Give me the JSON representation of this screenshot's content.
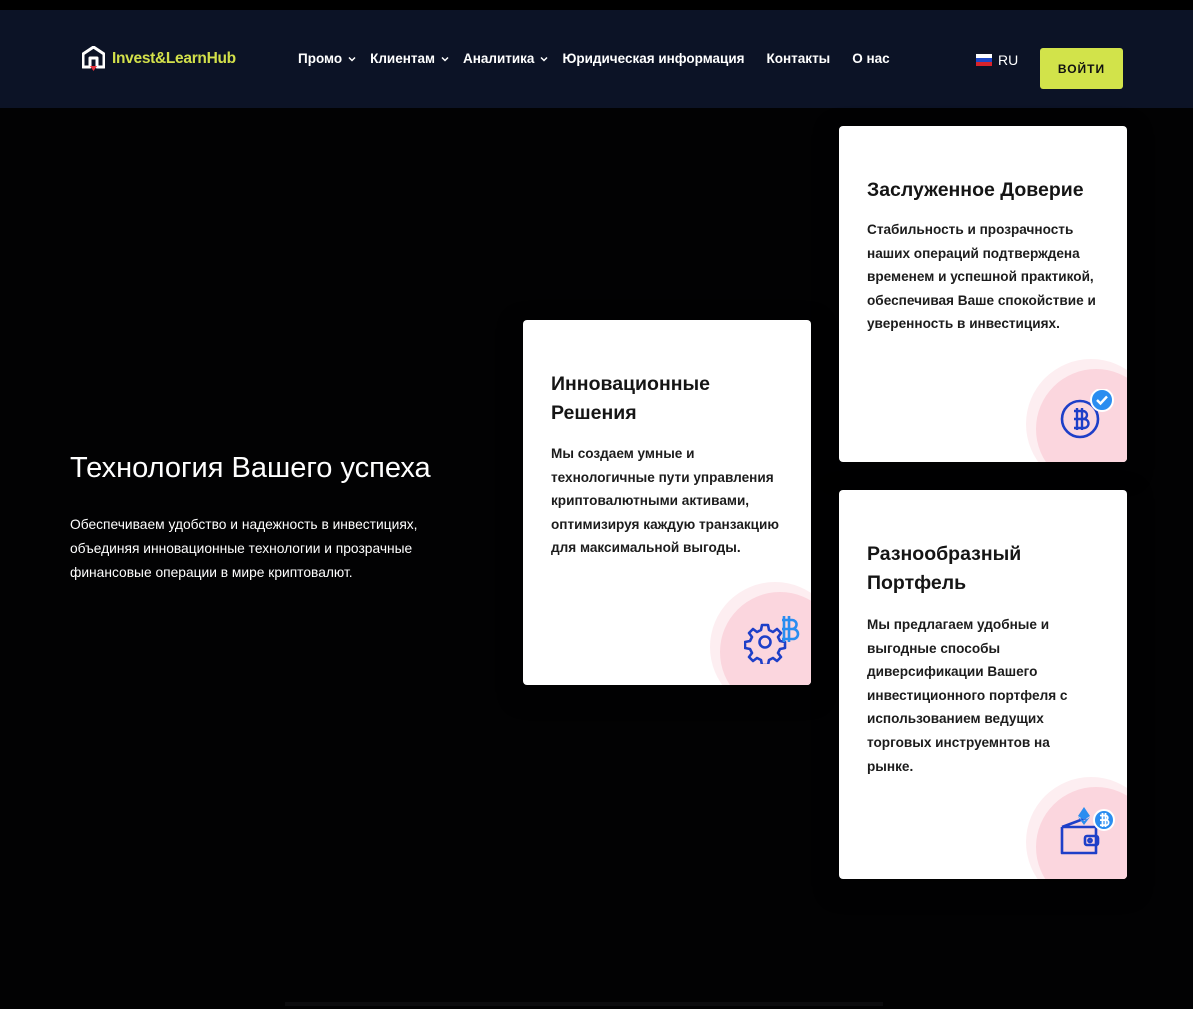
{
  "brand": {
    "name": "Invest&LearnHub",
    "logo_icon": "house-logo-icon",
    "accent": "#d3e04a"
  },
  "nav": {
    "items": [
      {
        "label": "Промо",
        "dropdown": true
      },
      {
        "label": "Клиентам",
        "dropdown": true
      },
      {
        "label": "Аналитика",
        "dropdown": true
      },
      {
        "label": "Юридическая информация",
        "dropdown": false
      },
      {
        "label": "Контакты",
        "dropdown": false
      },
      {
        "label": "О нас",
        "dropdown": false
      }
    ],
    "language": "RU",
    "flag_icon": "russia-flag-icon",
    "login_label": "ВОЙТИ"
  },
  "hero": {
    "title": "Технология Вашего успеха",
    "description": "Обеспечиваем удобство и надежность в инвестициях, объединяя инновационные технологии и прозрачные финансовые операции в мире криптовалют."
  },
  "cards": {
    "innovation": {
      "title": "Инновационные Решения",
      "text": "Мы создаем умные и технологичные пути управления криптовалютными активами, оптимизируя каждую транзакцию для максимальной выгоды.",
      "icon": "gear-bitcoin-icon"
    },
    "trust": {
      "title": "Заслуженное Доверие",
      "text": "Стабильность и прозрачность наших операций подтверждена временем и успешной практикой, обеспечивая Ваше спокойствие и уверенность в инвестициях.",
      "icon": "bitcoin-check-icon"
    },
    "portfolio": {
      "title": "Разнообразный Портфель",
      "text": "Мы предлагаем удобные и выгодные способы диверсификации Вашего инвестиционного портфеля с использованием ведущих торговых инструемнтов на рынке.",
      "icon": "crypto-wallet-icon"
    }
  },
  "colors": {
    "navbar_bg": "#0c1326",
    "page_bg": "#020203",
    "button_bg": "#d2e34a",
    "icon_blue": "#1e3fc8",
    "icon_light_blue": "#2a8df0"
  }
}
